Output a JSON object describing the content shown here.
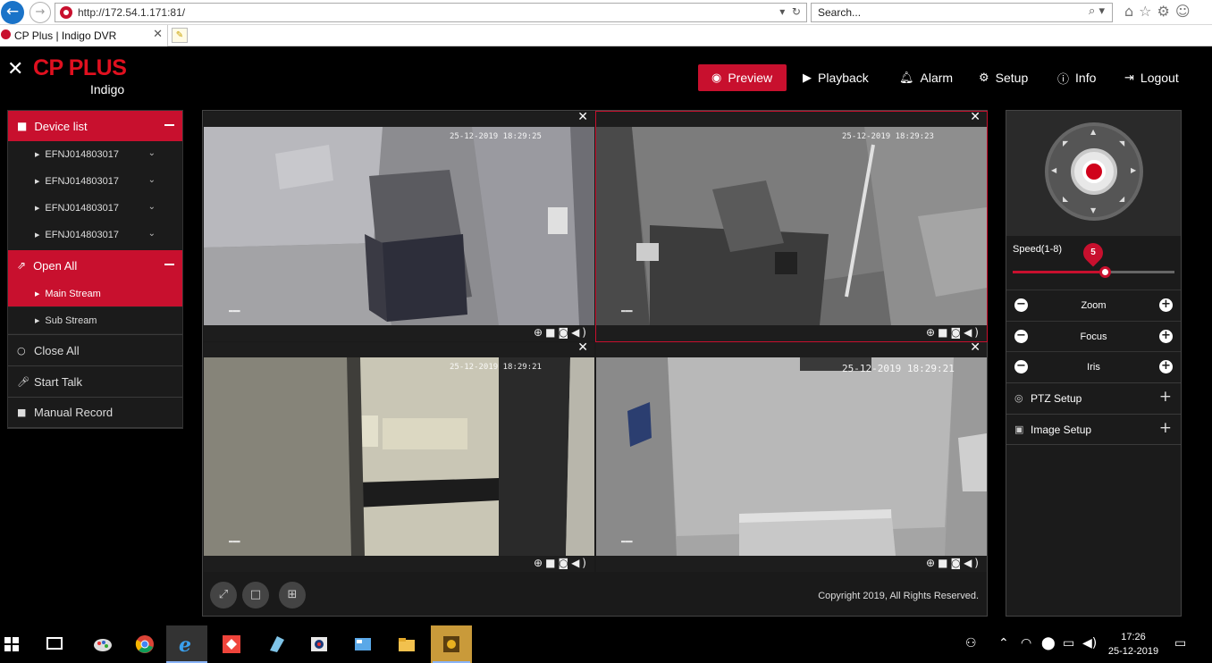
{
  "browser": {
    "url": "http://172.54.1.171:81/",
    "search_placeholder": "Search...",
    "tab_title": "CP Plus | Indigo DVR"
  },
  "app": {
    "brand": "CP PLUS",
    "product": "Indigo",
    "accent": "#c8102e"
  },
  "nav": [
    {
      "label": "Preview",
      "icon": "eye-icon",
      "active": true
    },
    {
      "label": "Playback",
      "icon": "play-circle-icon"
    },
    {
      "label": "Alarm",
      "icon": "bell-icon"
    },
    {
      "label": "Setup",
      "icon": "gear-icon"
    },
    {
      "label": "Info",
      "icon": "info-icon"
    },
    {
      "label": "Logout",
      "icon": "logout-icon"
    }
  ],
  "left_panel": {
    "device_list_label": "Device list",
    "devices": [
      "EFNJ014803017",
      "EFNJ014803017",
      "EFNJ014803017",
      "EFNJ014803017"
    ],
    "open_all_label": "Open All",
    "streams": [
      {
        "label": "Main Stream",
        "selected": true
      },
      {
        "label": "Sub Stream",
        "selected": false
      }
    ],
    "close_all_label": "Close All",
    "start_talk_label": "Start Talk",
    "manual_record_label": "Manual Record"
  },
  "cameras": [
    {
      "timestamp": "25-12-2019 18:29:25"
    },
    {
      "timestamp": "25-12-2019 18:29:23"
    },
    {
      "timestamp": "25-12-2019 18:29:21"
    },
    {
      "timestamp": "25-12-2019 18:29:21"
    }
  ],
  "video_area": {
    "copyright": "Copyright 2019, All Rights Reserved."
  },
  "right_panel": {
    "speed_label": "Speed(1-8)",
    "speed_value": "5",
    "speed_fraction": 0.57,
    "zoom_label": "Zoom",
    "focus_label": "Focus",
    "iris_label": "Iris",
    "ptz_setup_label": "PTZ Setup",
    "image_setup_label": "Image Setup"
  },
  "taskbar": {
    "time": "17:26",
    "date": "25-12-2019"
  }
}
